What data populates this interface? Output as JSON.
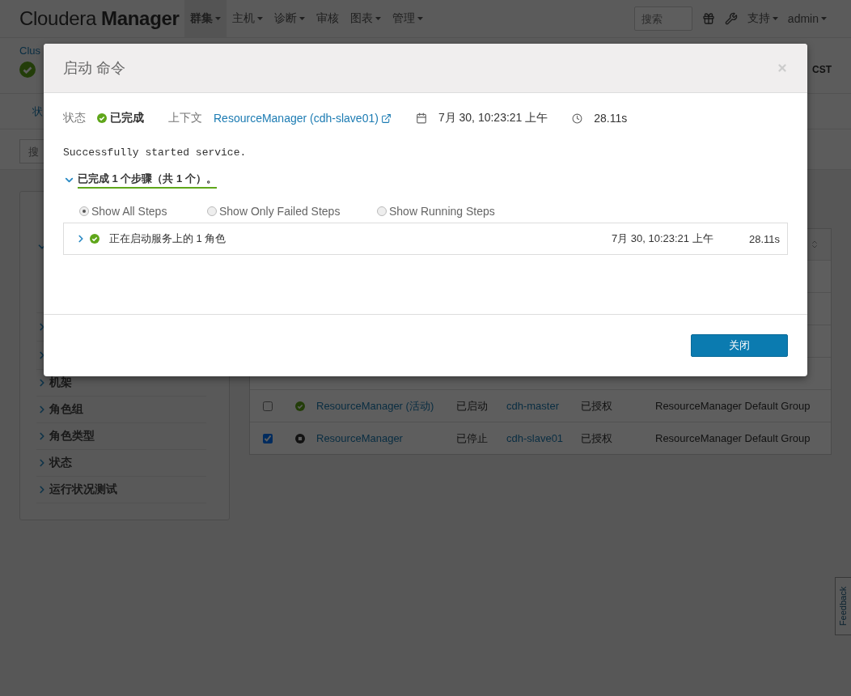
{
  "navbar": {
    "logo_light": "Cloudera",
    "logo_bold": "Manager",
    "menu": [
      {
        "label": "群集",
        "dropdown": true,
        "selected": true
      },
      {
        "label": "主机",
        "dropdown": true,
        "selected": false
      },
      {
        "label": "诊断",
        "dropdown": true,
        "selected": false
      },
      {
        "label": "审核",
        "dropdown": false,
        "selected": false
      },
      {
        "label": "图表",
        "dropdown": true,
        "selected": false
      },
      {
        "label": "管理",
        "dropdown": true,
        "selected": false
      }
    ],
    "search": {
      "placeholder": "搜索"
    },
    "right_menu": [
      {
        "label": "支持"
      },
      {
        "label": "admin"
      }
    ]
  },
  "header": {
    "cluster_link": "Clus",
    "timezone": "CST"
  },
  "tab_label": "状",
  "filter_search": {
    "placeholder": "搜"
  },
  "sidebar": {
    "items": [
      {
        "expanded": true
      },
      {
        "expanded": false
      },
      {
        "expanded": false
      },
      {
        "label": "机架",
        "expanded": false
      },
      {
        "label": "角色组",
        "expanded": false
      },
      {
        "label": "角色类型",
        "expanded": false
      },
      {
        "label": "状态",
        "expanded": false
      },
      {
        "label": "运行状况测试",
        "expanded": false
      }
    ]
  },
  "table": {
    "rows": [
      {
        "checked": false,
        "kind": "good",
        "name": "ResourceManager (活动)",
        "state": "已启动",
        "host": "cdh-master",
        "commission": "已授权",
        "group": "ResourceManager Default Group"
      },
      {
        "checked": true,
        "kind": "stopped",
        "name": "ResourceManager",
        "state": "已停止",
        "host": "cdh-slave01",
        "commission": "已授权",
        "group": "ResourceManager Default Group"
      }
    ]
  },
  "modal": {
    "title": "启动 命令",
    "status_label": "状态",
    "status": "已完成",
    "status_icon": {
      "kind": "good"
    },
    "context_label": "上下文",
    "context_link": "ResourceManager (cdh-slave01)",
    "date": "7月 30, 10:23:21 上午",
    "duration": "28.11s",
    "message": "Successfully started service.",
    "summary": "已完成 1 个步骤（共 1 个）。",
    "summary_expanded": true,
    "filters": [
      {
        "label": "Show All Steps",
        "selected": true
      },
      {
        "label": "Show Only Failed Steps",
        "selected": false
      },
      {
        "label": "Show Running Steps",
        "selected": false
      }
    ],
    "steps": [
      {
        "kind": "good",
        "expanded": false,
        "label": "正在启动服务上的 1 角色",
        "date": "7月 30, 10:23:21 上午",
        "duration": "28.11s"
      }
    ],
    "close_button": "关闭"
  },
  "feedback": "Feedback"
}
